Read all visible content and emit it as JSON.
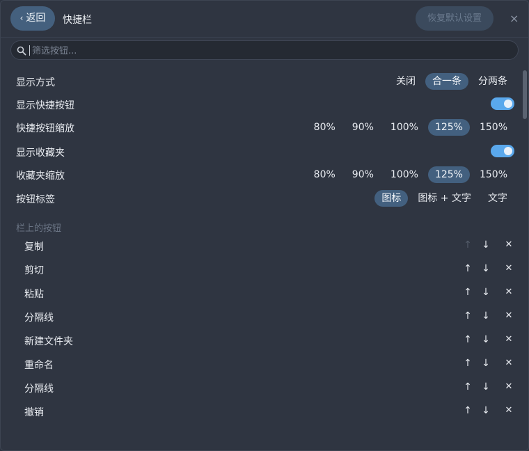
{
  "header": {
    "back_label": "返回",
    "back_icon": "chevron-left-icon",
    "title": "快捷栏",
    "reset_label": "恢复默认设置",
    "close_glyph": "×"
  },
  "search": {
    "placeholder": "筛选按钮..."
  },
  "settings": {
    "display_mode": {
      "label": "显示方式",
      "options": [
        "关闭",
        "合一条",
        "分两条"
      ],
      "selected": "合一条"
    },
    "show_quick_buttons": {
      "label": "显示快捷按钮",
      "on": true
    },
    "button_scale": {
      "label": "快捷按钮缩放",
      "options": [
        "80%",
        "90%",
        "100%",
        "125%",
        "150%"
      ],
      "selected": "125%"
    },
    "show_favorites": {
      "label": "显示收藏夹",
      "on": true
    },
    "favorites_scale": {
      "label": "收藏夹缩放",
      "options": [
        "80%",
        "90%",
        "100%",
        "125%",
        "150%"
      ],
      "selected": "125%"
    },
    "button_label": {
      "label": "按钮标签",
      "options": [
        "图标",
        "图标 + 文字",
        "文字"
      ],
      "selected": "图标"
    }
  },
  "section_title": "栏上的按钮",
  "bar_buttons": [
    {
      "label": "复制",
      "up_enabled": false
    },
    {
      "label": "剪切",
      "up_enabled": true
    },
    {
      "label": "粘贴",
      "up_enabled": true
    },
    {
      "label": "分隔线",
      "up_enabled": true
    },
    {
      "label": "新建文件夹",
      "up_enabled": true
    },
    {
      "label": "重命名",
      "up_enabled": true
    },
    {
      "label": "分隔线",
      "up_enabled": true
    },
    {
      "label": "撤销",
      "up_enabled": true
    }
  ],
  "controls": {
    "up": "↑",
    "down": "↓",
    "remove": "✕"
  },
  "colors": {
    "accent": "#5aa8ec",
    "selected_pill": "#43607f",
    "background": "#2f3541"
  }
}
